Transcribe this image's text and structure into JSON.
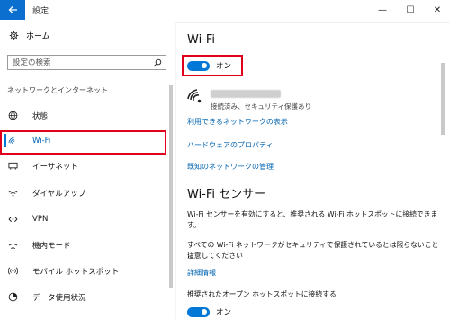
{
  "window": {
    "title": "設定",
    "controls": {
      "minimize": "—",
      "maximize": "☐",
      "close": "✕"
    }
  },
  "sidebar": {
    "home": "ホーム",
    "search_placeholder": "設定の検索",
    "section": "ネットワークとインターネット",
    "items": [
      {
        "label": "状態",
        "icon": "globe-icon"
      },
      {
        "label": "Wi-Fi",
        "icon": "wifi-icon",
        "selected": true
      },
      {
        "label": "イーサネット",
        "icon": "ethernet-icon"
      },
      {
        "label": "ダイヤルアップ",
        "icon": "dialup-icon"
      },
      {
        "label": "VPN",
        "icon": "vpn-icon"
      },
      {
        "label": "機内モード",
        "icon": "airplane-icon"
      },
      {
        "label": "モバイル ホットスポット",
        "icon": "hotspot-icon"
      },
      {
        "label": "データ使用状況",
        "icon": "data-usage-icon"
      }
    ]
  },
  "main": {
    "title": "Wi-Fi",
    "wifi_toggle": {
      "state": "オン",
      "on": true
    },
    "network_status": "接続済み、セキュリティ保護あり",
    "links": {
      "available": "利用できるネットワークの表示",
      "hardware": "ハードウェアのプロパティ",
      "known": "既知のネットワークの管理"
    },
    "sense": {
      "title": "Wi-Fi センサー",
      "desc": "Wi-Fi センサーを有効にすると、推奨される Wi-Fi ホットスポットに接続できます。",
      "warning_line1": "すべての Wi-Fi ネットワークがセキュリティで保護されているとは限らないことに",
      "warning_line2": "注意してください",
      "details_link": "詳細情報",
      "open_hotspot_label": "推奨されたオープン ホットスポットに接続する",
      "open_hotspot_toggle": {
        "state": "オン",
        "on": true
      }
    }
  },
  "colors": {
    "accent": "#0078d7",
    "highlight": "#e0001b",
    "link": "#0063b1"
  }
}
